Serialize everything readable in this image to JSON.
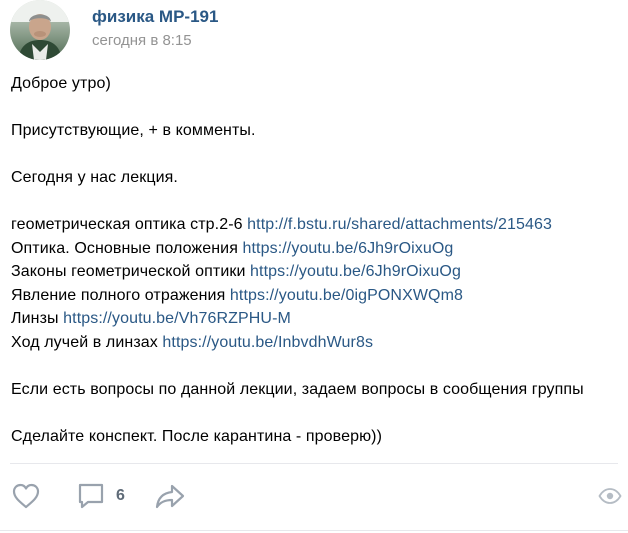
{
  "post": {
    "author": "физика МР-191",
    "time": "сегодня в 8:15",
    "greeting": "Доброе утро)",
    "attendance": "Присутствующие, + в комменты.",
    "lecture_intro": "Сегодня у нас лекция.",
    "materials": [
      {
        "text": "геометрическая оптика стр.2-6 ",
        "link": "http://f.bstu.ru/shared/attachments/215463"
      },
      {
        "text": "Оптика. Основные положения ",
        "link": "https://youtu.be/6Jh9rOixuOg"
      },
      {
        "text": "Законы геометрической оптики ",
        "link": "https://youtu.be/6Jh9rOixuOg"
      },
      {
        "text": "Явление полного отражения ",
        "link": "https://youtu.be/0igPONXWQm8"
      },
      {
        "text": "Линзы ",
        "link": "https://youtu.be/Vh76RZPHU-M"
      },
      {
        "text": "Ход лучей в линзах ",
        "link": "https://youtu.be/InbvdhWur8s"
      }
    ],
    "questions": "Если есть вопросы по данной лекции, задаем вопросы в сообщения группы",
    "closing": "Сделайте конспект. После карантина - проверю))"
  },
  "actions": {
    "like_icon": "heart-icon",
    "comment_icon": "comment-icon",
    "comment_count": "6",
    "share_icon": "share-arrow-icon",
    "views_icon": "eye-icon"
  },
  "colors": {
    "link": "#2a5885",
    "time": "#939393",
    "icon": "#99a2ad",
    "divider": "#e7e8ec"
  }
}
